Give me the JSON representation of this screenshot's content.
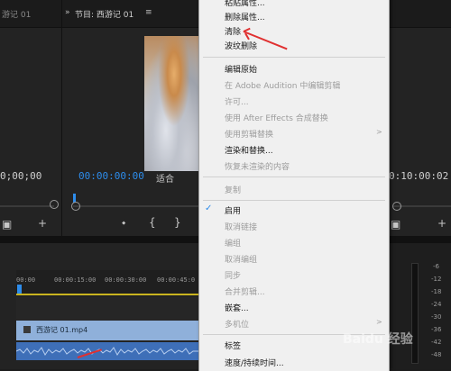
{
  "left_panel": {
    "tab_title": "游记 01",
    "timecode": "0;00;00"
  },
  "program_monitor": {
    "tab_title": "节目: 西游记 01",
    "timecode": "00:00:00:00",
    "fit_label": "适合",
    "chevron": "»"
  },
  "right_panel": {
    "timecode": "0:10:00:02",
    "meter_labels": [
      "-6",
      "-12",
      "-18",
      "-24",
      "-30",
      "-36",
      "-42",
      "-48"
    ]
  },
  "timeline": {
    "ruler_labels": [
      "00:00",
      "00:00:15:00",
      "00:00:30:00",
      "00:00:45:0"
    ],
    "video_clip_name": "西游记 01.mp4"
  },
  "context_menu": {
    "items": [
      {
        "label": "粘贴属性...",
        "disabled": false
      },
      {
        "label": "删除属性...",
        "disabled": false
      },
      {
        "label": "清除",
        "disabled": false
      },
      {
        "label": "波纹删除",
        "disabled": false
      },
      {
        "label": "编辑原始",
        "disabled": false
      },
      {
        "label": "在 Adobe Audition 中编辑剪辑",
        "disabled": true
      },
      {
        "label": "许可...",
        "disabled": true
      },
      {
        "label": "使用 After Effects 合成替换",
        "disabled": true
      },
      {
        "label": "使用剪辑替换",
        "disabled": true,
        "submenu": true
      },
      {
        "label": "渲染和替换...",
        "disabled": false
      },
      {
        "label": "恢复未渲染的内容",
        "disabled": true
      },
      {
        "label": "复制",
        "disabled": true
      },
      {
        "label": "启用",
        "disabled": false,
        "checked": true
      },
      {
        "label": "取消链接",
        "disabled": true
      },
      {
        "label": "编组",
        "disabled": true
      },
      {
        "label": "取消编组",
        "disabled": true
      },
      {
        "label": "同步",
        "disabled": true
      },
      {
        "label": "合并剪辑...",
        "disabled": true
      },
      {
        "label": "嵌套...",
        "disabled": false
      },
      {
        "label": "多机位",
        "disabled": true,
        "submenu": true
      },
      {
        "label": "标签",
        "disabled": false
      },
      {
        "label": "速度/持续时间...",
        "disabled": false
      }
    ],
    "check_mark": "✓",
    "submenu_arrow": ">"
  },
  "watermark": "Baidu 经验",
  "colors": {
    "accent_blue": "#2d8ceb",
    "annotation_red": "#e03030",
    "clip_video": "#8fb0da",
    "clip_audio": "#3e6fb8",
    "in_out_bar": "#c9b41f"
  }
}
